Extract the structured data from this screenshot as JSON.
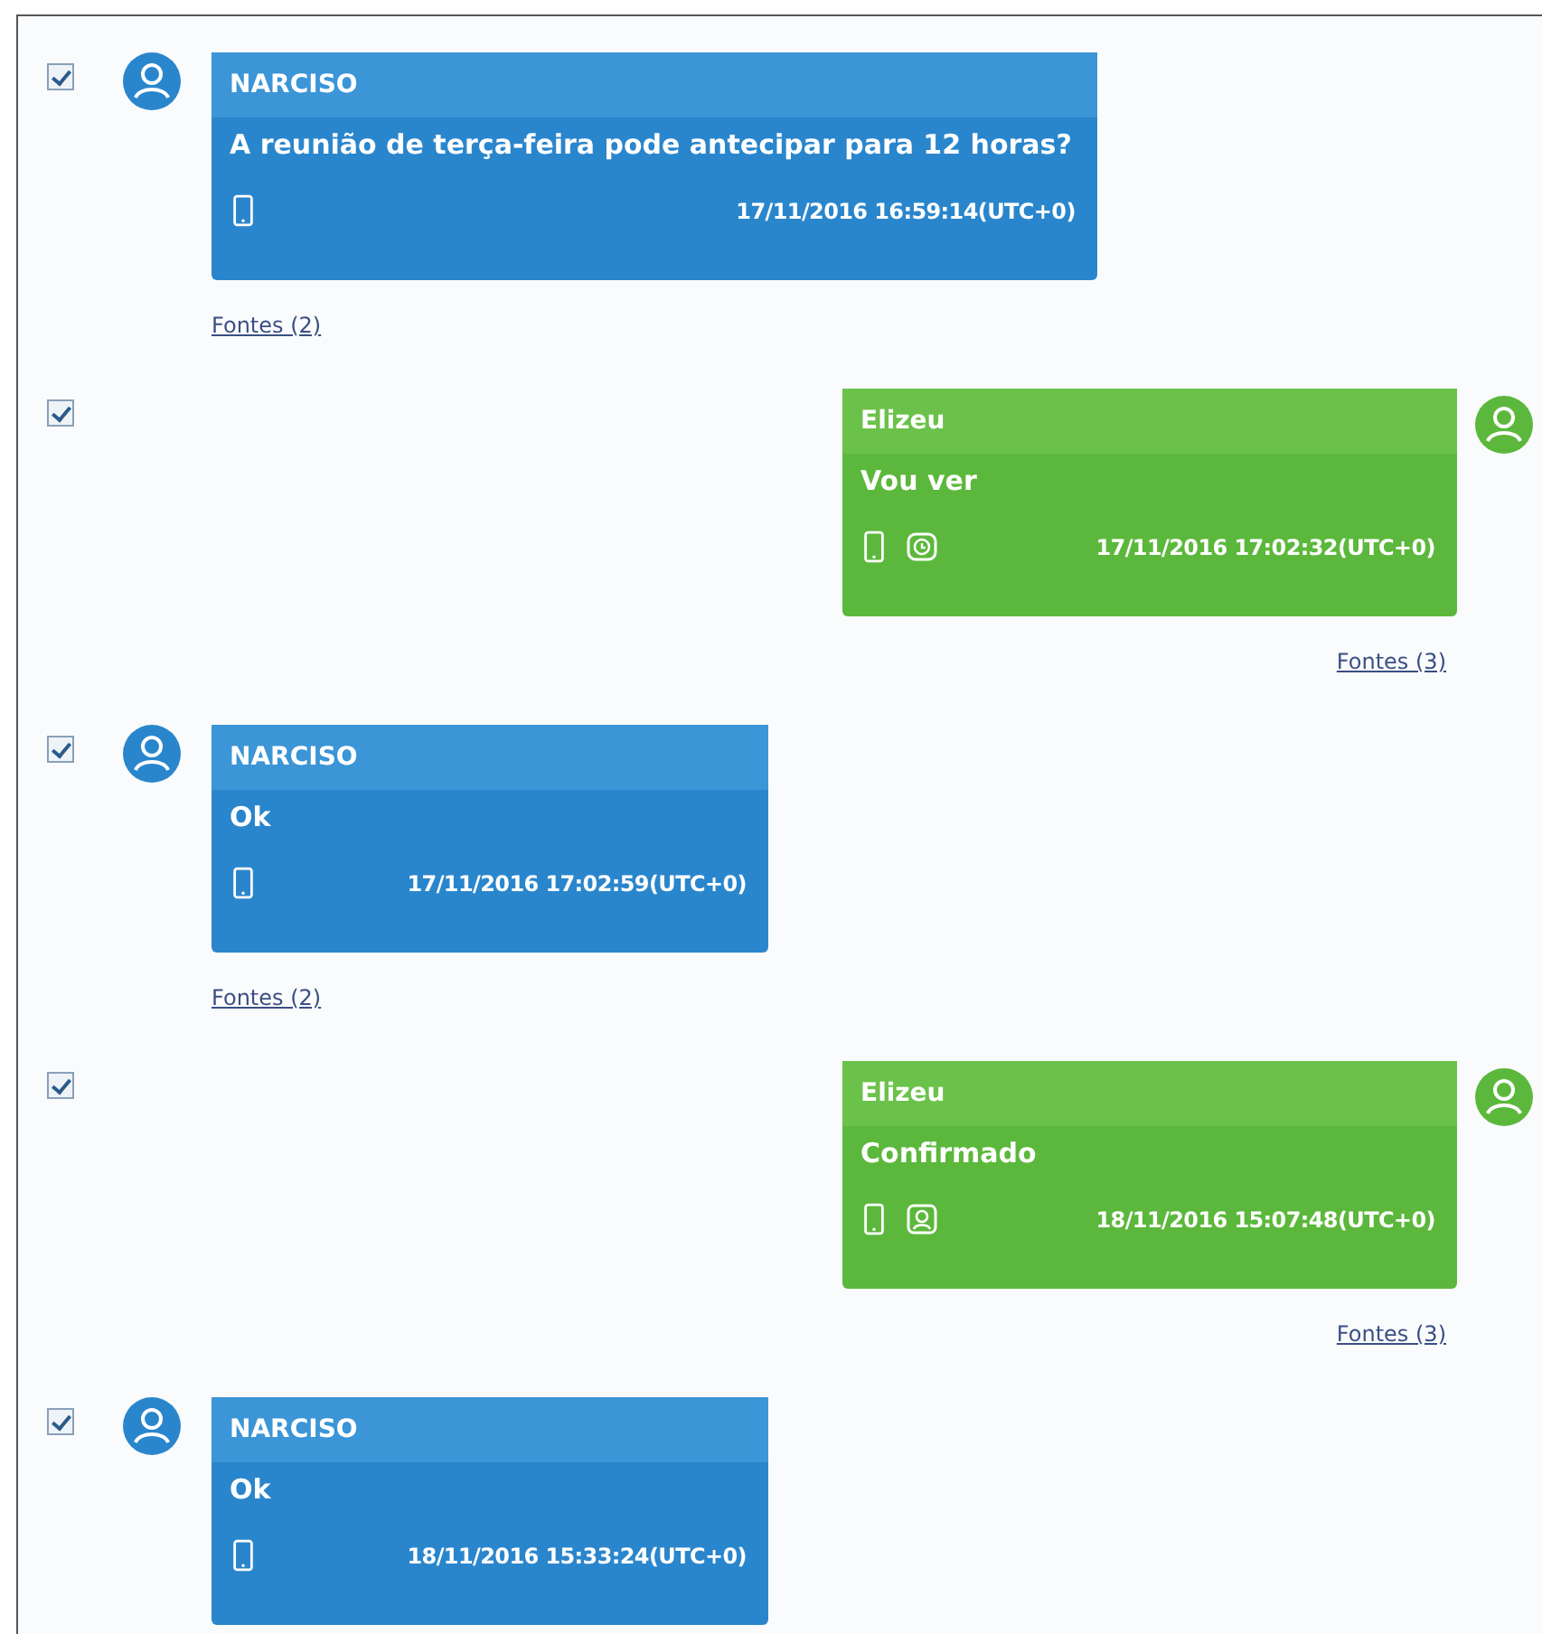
{
  "messages": [
    {
      "kind": "incoming",
      "checked": true,
      "sender": "NARCISO",
      "text": "A reunião de terça-feira pode antecipar para 12 horas?",
      "icons": [
        {
          "kind": "phone"
        }
      ],
      "timestamp": "17/11/2016 16:59:14(UTC+0)",
      "sources": "Fontes (2)"
    },
    {
      "kind": "outgoing",
      "checked": true,
      "sender": "Elizeu",
      "text": "Vou ver",
      "icons": [
        {
          "kind": "phone"
        },
        {
          "kind": "clock"
        }
      ],
      "timestamp": "17/11/2016 17:02:32(UTC+0)",
      "sources": "Fontes (3)"
    },
    {
      "kind": "incoming",
      "checked": true,
      "sender": "NARCISO",
      "text": "Ok",
      "icons": [
        {
          "kind": "phone"
        }
      ],
      "timestamp": "17/11/2016 17:02:59(UTC+0)",
      "sources": "Fontes (2)"
    },
    {
      "kind": "outgoing",
      "checked": true,
      "sender": "Elizeu",
      "text": "Confirmado",
      "icons": [
        {
          "kind": "phone"
        },
        {
          "kind": "contact"
        }
      ],
      "timestamp": "18/11/2016 15:07:48(UTC+0)",
      "sources": "Fontes (3)"
    },
    {
      "kind": "incoming",
      "checked": true,
      "sender": "NARCISO",
      "text": "Ok",
      "icons": [
        {
          "kind": "phone"
        }
      ],
      "timestamp": "18/11/2016 15:33:24(UTC+0)"
    }
  ]
}
